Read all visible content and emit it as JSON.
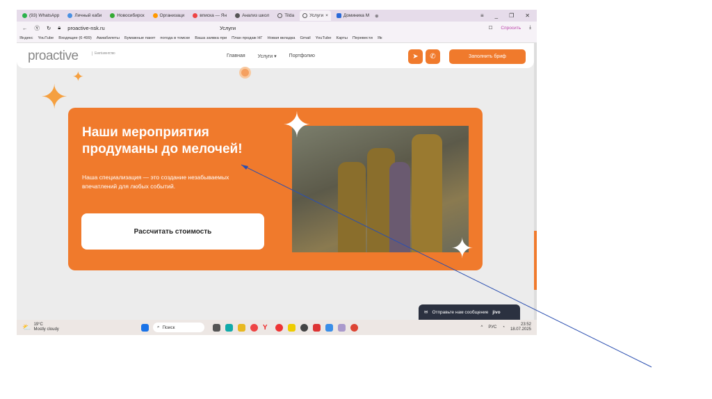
{
  "browser": {
    "tabs": [
      "(93) WhatsApp",
      "Личный каби",
      "Новосибирск",
      "Организаци",
      "вписка — Ян",
      "Анализ школ",
      "Tilda",
      "Услуги",
      "Доминика М"
    ],
    "url": "proactive-nsk.ru",
    "page_title": "Услуги",
    "ask": "Спросить",
    "bookmarks": [
      "Яндекс",
      "YouTube",
      "Входящие (6 499)",
      "Авиабилеты",
      "Бумажные пакет",
      "погода в томске",
      "Ваша заявка при",
      "План продаж НГ",
      "Новая вкладка",
      "Gmail",
      "YouTube",
      "Карты",
      "Перевести",
      "Як"
    ]
  },
  "site": {
    "logo": "proactive",
    "logo_sub": "Event агентство",
    "nav": [
      "Главная",
      "Услуги ▾",
      "Портфолио"
    ],
    "brief_button": "Заполнить бриф",
    "hero_title": "Наши мероприятия продуманы до мелочей!",
    "hero_text": "Наша специализация — это создание незабываемых впечатлений для любых событий.",
    "cta": "Рассчитать стоимость",
    "chat": "Отправьте нам сообщение",
    "chat_brand": "jivo"
  },
  "taskbar": {
    "temp": "19°C",
    "weather": "Mostly cloudy",
    "search": "Поиск",
    "lang": "РУС",
    "time": "23:52",
    "date": "18.07.2025"
  }
}
